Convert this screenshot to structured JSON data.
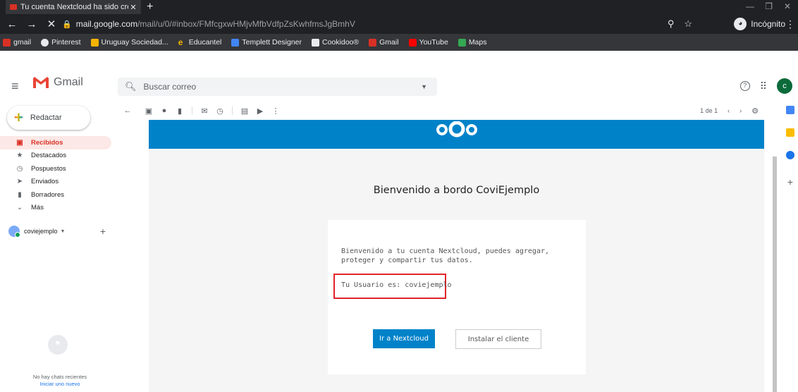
{
  "browser": {
    "tab_title": "Tu cuenta Nextcloud ha sido creá",
    "url_host": "mail.google.com",
    "url_path": "/mail/u/0/#inbox/FMfcgxwHMjvMfbVdfpZsKwhfmsJgBmhV",
    "incognito_label": "Incógnito",
    "bookmarks": [
      {
        "label": "gmail",
        "color": "#d93025"
      },
      {
        "label": "Pinterest",
        "color": "#e8eaed"
      },
      {
        "label": "Uruguay Sociedad...",
        "color": "#f4b400"
      },
      {
        "label": "Educantel",
        "color": "#f4b400"
      },
      {
        "label": "Templett Designer",
        "color": "#4285f4"
      },
      {
        "label": "Cookidoo®",
        "color": "#34a853"
      },
      {
        "label": "Gmail",
        "color": "#d93025"
      },
      {
        "label": "YouTube",
        "color": "#ff0000"
      },
      {
        "label": "Maps",
        "color": "#34a853"
      }
    ]
  },
  "gmail": {
    "app_name": "Gmail",
    "search_placeholder": "Buscar correo",
    "avatar_letter": "c",
    "compose_label": "Redactar",
    "nav": [
      {
        "label": "Recibidos",
        "icon": "inbox-icon"
      },
      {
        "label": "Destacados",
        "icon": "star-icon"
      },
      {
        "label": "Pospuestos",
        "icon": "clock-icon"
      },
      {
        "label": "Enviados",
        "icon": "send-icon"
      },
      {
        "label": "Borradores",
        "icon": "draft-icon"
      },
      {
        "label": "Más",
        "icon": "chevron-down-icon"
      }
    ],
    "hangouts_user": "coviejemplo",
    "no_chats": "No hay chats recientes",
    "start_chat": "Iniciar uno nuevo",
    "pager": "1 de 1"
  },
  "email": {
    "title": "Bienvenido a bordo CoviEjemplo",
    "body": "Bienvenido a tu cuenta Nextcloud, puedes agregar, proteger y compartir tus datos.",
    "user_line": "Tu Usuario es: coviejemplo",
    "primary_button": "Ir a Nextcloud",
    "secondary_button": "Instalar el cliente",
    "brand_color": "#0082c9"
  }
}
